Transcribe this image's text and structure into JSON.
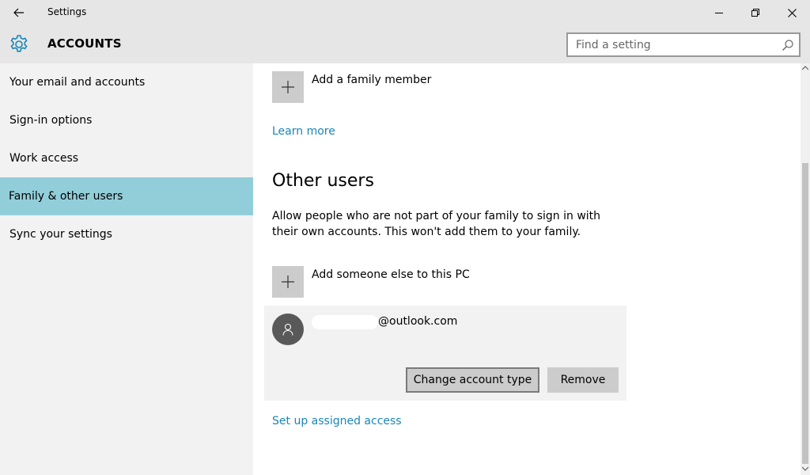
{
  "window": {
    "title": "Settings",
    "icons": {
      "back": "back-arrow-icon",
      "minimize": "minimize-icon",
      "maximize": "restore-icon",
      "close": "close-icon"
    }
  },
  "header": {
    "title": "ACCOUNTS",
    "icon": "gear-icon",
    "accent": "#1a86b8",
    "search": {
      "placeholder": "Find a setting",
      "value": "",
      "icon": "search-icon"
    }
  },
  "sidebar": {
    "items": [
      {
        "label": "Your email and accounts"
      },
      {
        "label": "Sign-in options"
      },
      {
        "label": "Work access"
      },
      {
        "label": "Family & other users",
        "selected": true
      },
      {
        "label": "Sync your settings"
      }
    ],
    "selected_color": "#92ceda"
  },
  "main": {
    "add_family": "Add a family member",
    "learn_more": "Learn more",
    "other_users_title": "Other users",
    "other_users_desc": "Allow people who are not part of your family to sign in with their own accounts. This won't add them to your family.",
    "add_someone": "Add someone else to this PC",
    "user": {
      "email": "@outlook.com",
      "change_type": "Change account type",
      "remove": "Remove"
    },
    "assigned_access": "Set up assigned access"
  }
}
